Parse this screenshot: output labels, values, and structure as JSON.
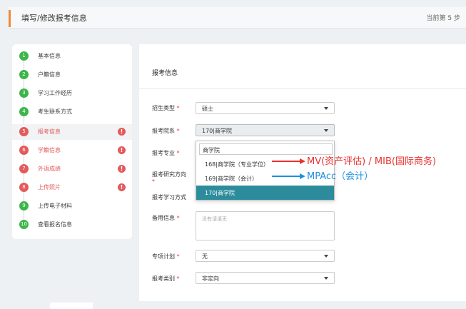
{
  "header": {
    "title": "填写/修改报考信息",
    "step": "当前第 5 步"
  },
  "sidebar": {
    "items": [
      {
        "num": "1",
        "label": "基本信息",
        "status": "done"
      },
      {
        "num": "2",
        "label": "户籍信息",
        "status": "done"
      },
      {
        "num": "3",
        "label": "学习工作经历",
        "status": "done"
      },
      {
        "num": "4",
        "label": "考生联系方式",
        "status": "done"
      },
      {
        "num": "5",
        "label": "报考信息",
        "status": "current"
      },
      {
        "num": "6",
        "label": "学籍信息",
        "status": "error"
      },
      {
        "num": "7",
        "label": "外语成绩",
        "status": "error"
      },
      {
        "num": "8",
        "label": "上传照片",
        "status": "error"
      },
      {
        "num": "9",
        "label": "上传电子材料",
        "status": "done"
      },
      {
        "num": "10",
        "label": "查看报名信息",
        "status": "done"
      }
    ],
    "warn_glyph": "!"
  },
  "form": {
    "section_title": "报考信息",
    "fields": {
      "admission_type": {
        "label": "招生类型",
        "value": "硕士"
      },
      "department": {
        "label": "报考院系",
        "value": "170|商学院"
      },
      "major": {
        "label": "报考专业"
      },
      "research_direction": {
        "label": "报考研究方向"
      },
      "study_mode": {
        "label": "报考学习方式"
      },
      "remarks": {
        "label": "备用信息",
        "placeholder": "没有请填无"
      },
      "special_plan": {
        "label": "专项计划",
        "value": "无"
      },
      "category": {
        "label": "报考类别",
        "value": "非定向"
      }
    },
    "required_mark": "*"
  },
  "dropdown": {
    "search_value": "商学院",
    "options": [
      {
        "label": "168|商学院（专业学位）",
        "selected": false
      },
      {
        "label": "169|商学院（会计）",
        "selected": false
      },
      {
        "label": "170|商学院",
        "selected": true
      }
    ]
  },
  "annotations": {
    "red": "MV(资产评估) / MIB(国际商务)",
    "blue": "MPAcc（会计）"
  },
  "colors": {
    "accent_orange": "#f0883a",
    "done_green": "#3db54a",
    "error_red": "#e35b5b",
    "selected_teal": "#2c8c9c",
    "annotation_red": "#e8322f",
    "annotation_blue": "#1f8fe0"
  }
}
